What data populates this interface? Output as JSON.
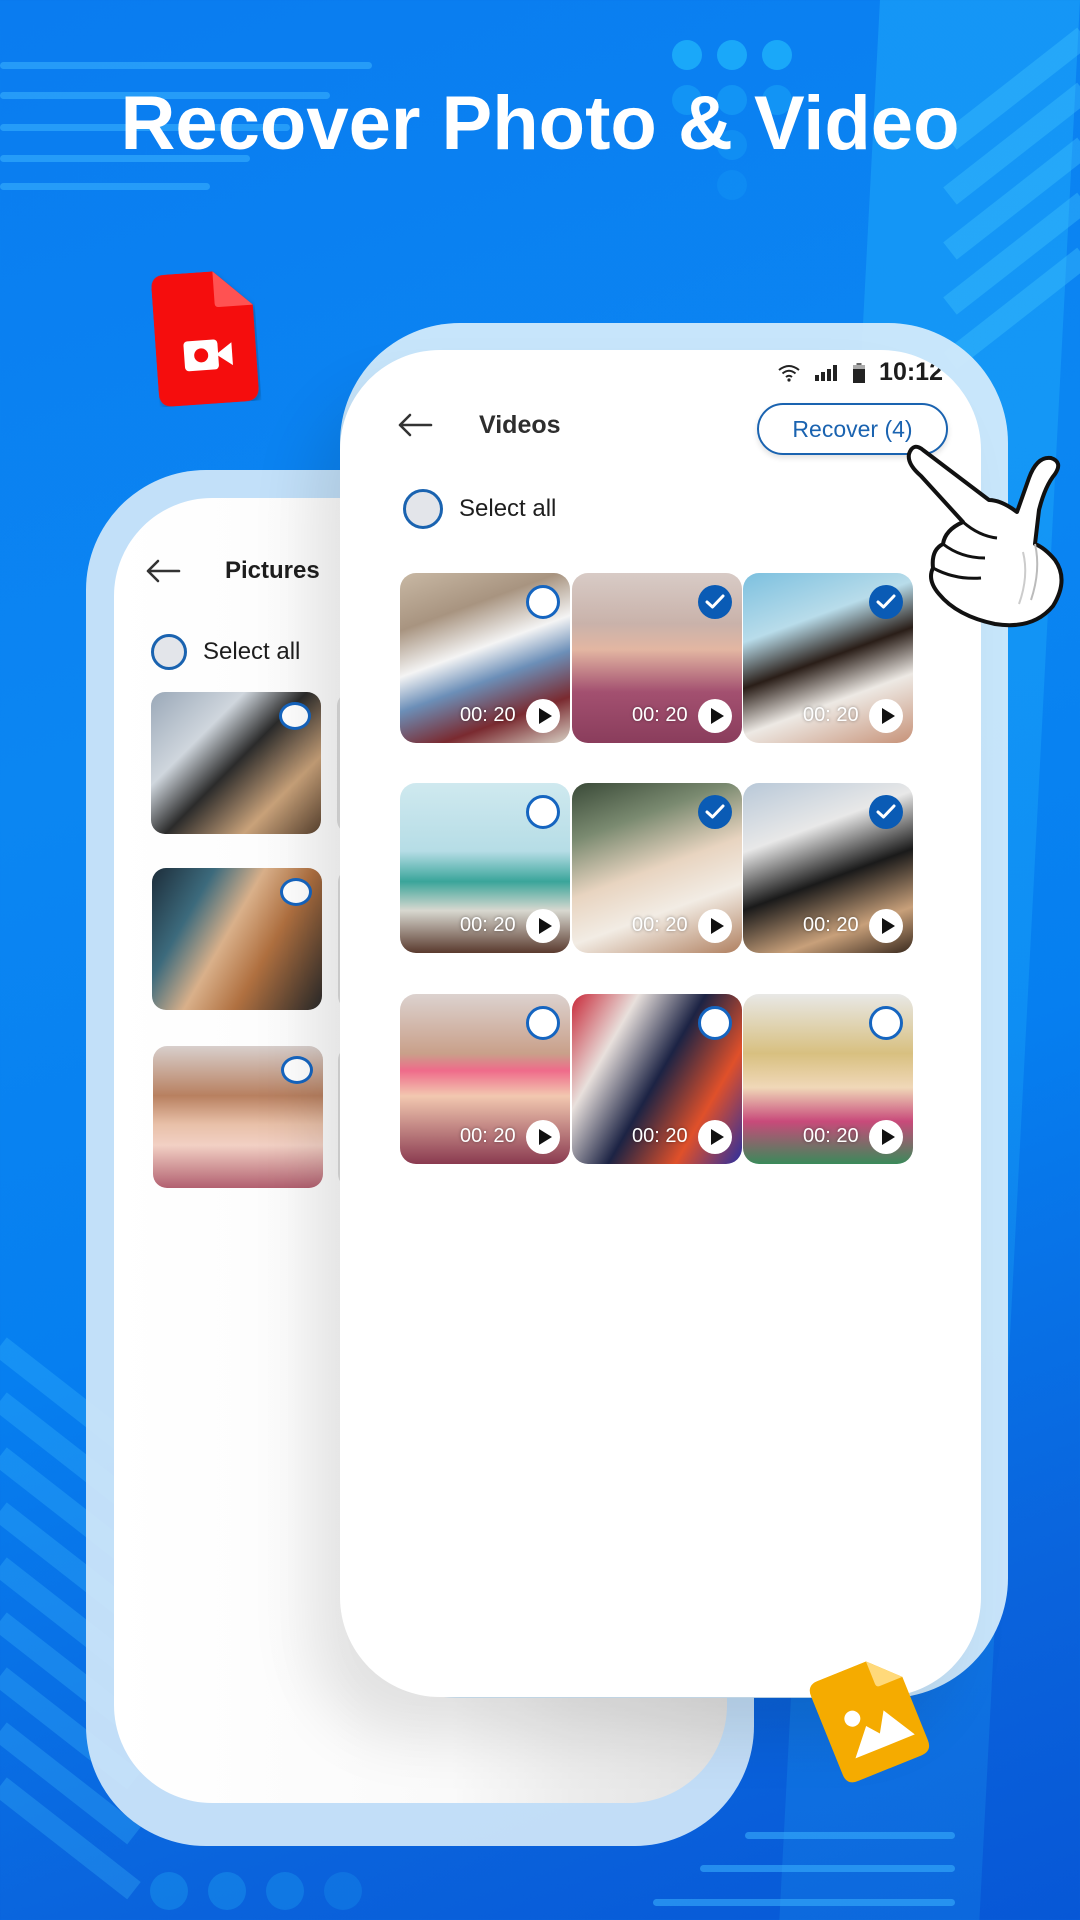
{
  "headline": "Recover Photo & Video",
  "colors": {
    "accent": "#1a63b0",
    "checked": "#0a5bb5",
    "background": "#0a7cf0",
    "video_file_icon": "#f50d0d",
    "image_file_icon": "#f5ab00"
  },
  "front_screen": {
    "status_bar": {
      "icons": [
        "wifi-icon",
        "signal-icon",
        "battery-icon"
      ],
      "time": "10:12"
    },
    "header": {
      "back_icon": "arrow-left-icon",
      "title": "Videos",
      "recover_button": "Recover (4)"
    },
    "select_all": {
      "label": "Select all",
      "checked": false
    },
    "videos": [
      {
        "subject": "couple walking",
        "duration": "00: 20",
        "selected": false
      },
      {
        "subject": "woman pink top",
        "duration": "00: 20",
        "selected": true
      },
      {
        "subject": "woman braids",
        "duration": "00: 20",
        "selected": true
      },
      {
        "subject": "woman dome",
        "duration": "00: 20",
        "selected": false
      },
      {
        "subject": "woman hijab",
        "duration": "00: 20",
        "selected": true
      },
      {
        "subject": "woman laptop",
        "duration": "00: 20",
        "selected": true
      },
      {
        "subject": "woman cupcake glasses",
        "duration": "00: 20",
        "selected": false
      },
      {
        "subject": "woman graffiti",
        "duration": "00: 20",
        "selected": false
      },
      {
        "subject": "woman blonde",
        "duration": "00: 20",
        "selected": false
      }
    ]
  },
  "back_screen": {
    "header": {
      "back_icon": "arrow-left-icon",
      "title": "Pictures"
    },
    "select_all": {
      "label": "Select all",
      "checked": false
    },
    "pictures": [
      {
        "subject": "woman laptop",
        "selected": false
      },
      {
        "subject": "woman long hair",
        "selected": false
      },
      {
        "subject": "woman cupcake",
        "selected": false
      }
    ]
  },
  "decorations": {
    "video_file_icon": "video-file-icon",
    "image_file_icon": "image-file-icon",
    "pointer": "pointing-hand-icon"
  }
}
